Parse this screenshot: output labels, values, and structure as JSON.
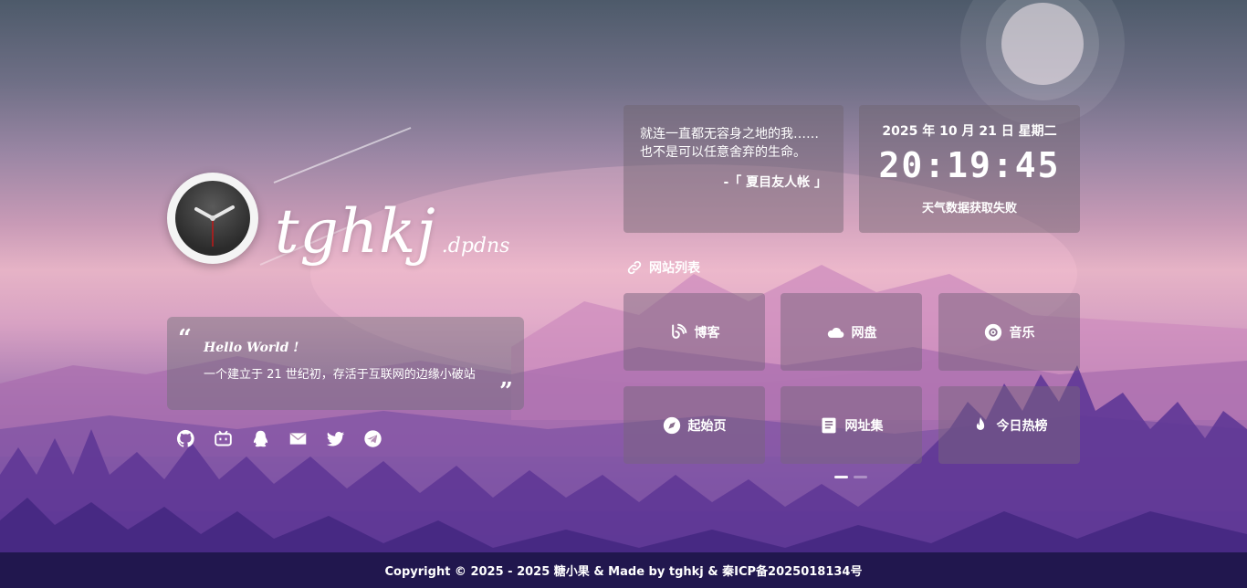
{
  "brand": {
    "name": "tghkj",
    "suffix": ".dpdns"
  },
  "intro": {
    "greeting": "Hello World !",
    "description": "一个建立于 21 世纪初，存活于互联网的边缘小破站"
  },
  "socials": [
    {
      "icon": "github-icon"
    },
    {
      "icon": "bilibili-icon"
    },
    {
      "icon": "qq-icon"
    },
    {
      "icon": "mail-icon"
    },
    {
      "icon": "twitter-icon"
    },
    {
      "icon": "telegram-icon"
    }
  ],
  "hitokoto": {
    "text": "就连一直都无容身之地的我……也不是可以任意舍弃的生命。",
    "from": "-「 夏目友人帐 」"
  },
  "clock": {
    "date": "2025 年 10 月 21 日 星期二",
    "time": "20:19:45",
    "weather": "天气数据获取失败"
  },
  "sites": {
    "title": "网站列表",
    "items": [
      {
        "label": "博客",
        "icon": "blog-icon"
      },
      {
        "label": "网盘",
        "icon": "cloud-icon"
      },
      {
        "label": "音乐",
        "icon": "disc-icon"
      },
      {
        "label": "起始页",
        "icon": "compass-icon"
      },
      {
        "label": "网址集",
        "icon": "book-icon"
      },
      {
        "label": "今日热榜",
        "icon": "fire-icon"
      }
    ],
    "page": 1,
    "pages": 2
  },
  "footer": {
    "text": "Copyright © 2025 - 2025 糖小果 & Made by tghkj & 秦ICP备2025018134号"
  },
  "colors": {
    "card_bg": "#6e646e",
    "footer_bg": "#14123c"
  }
}
